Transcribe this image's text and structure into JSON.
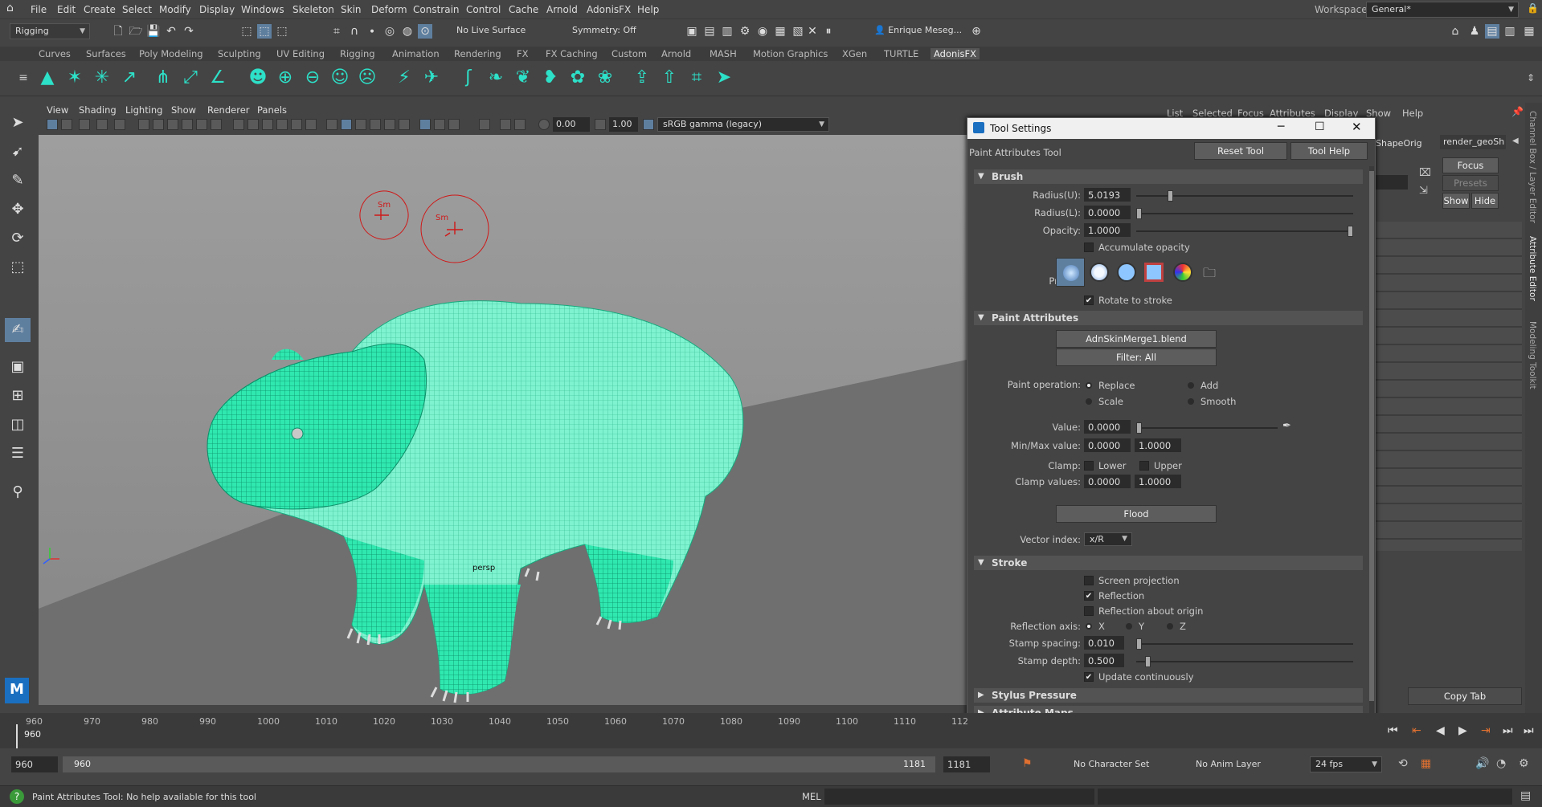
{
  "menubar": {
    "items": [
      "File",
      "Edit",
      "Create",
      "Select",
      "Modify",
      "Display",
      "Windows",
      "Skeleton",
      "Skin",
      "Deform",
      "Constrain",
      "Control",
      "Cache",
      "Arnold",
      "AdonisFX",
      "Help"
    ],
    "workspace_label": "Workspace:",
    "workspace_value": "General*"
  },
  "statusline": {
    "mode": "Rigging",
    "live_surface": "No Live Surface",
    "symmetry": "Symmetry: Off",
    "user": "Enrique Meseg..."
  },
  "shelf": {
    "tabs": [
      "Curves",
      "Surfaces",
      "Poly Modeling",
      "Sculpting",
      "UV Editing",
      "Rigging",
      "Animation",
      "Rendering",
      "FX",
      "FX Caching",
      "Custom",
      "Arnold",
      "MASH",
      "Motion Graphics",
      "XGen",
      "TURTLE",
      "AdonisFX"
    ],
    "active_tab": "AdonisFX"
  },
  "viewport": {
    "menus": [
      "View",
      "Shading",
      "Lighting",
      "Show",
      "Renderer",
      "Panels"
    ],
    "exposure": "0.00",
    "gamma": "1.00",
    "colorspace": "sRGB gamma (legacy)",
    "camera": "persp",
    "brush_label_1": "Sm",
    "brush_label_2": "Sm"
  },
  "right_panel": {
    "menus": [
      "List",
      "Selected",
      "Focus",
      "Attributes",
      "Display",
      "Show",
      "Help"
    ],
    "tab1": "ShapeOrig",
    "tab2": "render_geoSh",
    "focus": "Focus",
    "presets": "Presets",
    "show": "Show",
    "hide": "Hide",
    "copy_tab": "Copy Tab",
    "side_tabs": [
      "Channel Box / Layer Editor",
      "Attribute Editor",
      "Modeling Toolkit"
    ]
  },
  "tool_settings": {
    "title": "Tool Settings",
    "tool_name": "Paint Attributes Tool",
    "reset": "Reset Tool",
    "help": "Tool Help",
    "brush": {
      "header": "Brush",
      "radius_u_label": "Radius(U):",
      "radius_u": "5.0193",
      "radius_u_pos": 0.15,
      "radius_l_label": "Radius(L):",
      "radius_l": "0.0000",
      "radius_l_pos": 0.0,
      "opacity_label": "Opacity:",
      "opacity": "1.0000",
      "opacity_pos": 1.0,
      "accumulate": "Accumulate opacity",
      "accumulate_checked": false,
      "profile_label": "Profile:",
      "rotate": "Rotate to stroke",
      "rotate_checked": true
    },
    "paint_attributes": {
      "header": "Paint Attributes",
      "attribute": "AdnSkinMerge1.blend",
      "filter": "Filter: All",
      "operation_label": "Paint operation:",
      "ops": [
        "Replace",
        "Add",
        "Scale",
        "Smooth"
      ],
      "selected_op": "Replace",
      "value_label": "Value:",
      "value": "0.0000",
      "value_pos": 0.0,
      "minmax_label": "Min/Max value:",
      "min": "0.0000",
      "max": "1.0000",
      "clamp_label": "Clamp:",
      "clamp_lower": "Lower",
      "clamp_upper": "Upper",
      "clamp_values_label": "Clamp values:",
      "clamp_min": "0.0000",
      "clamp_max": "1.0000",
      "flood": "Flood",
      "vector_label": "Vector index:",
      "vector": "x/R"
    },
    "stroke": {
      "header": "Stroke",
      "screen_projection": "Screen projection",
      "screen_projection_checked": false,
      "reflection": "Reflection",
      "reflection_checked": true,
      "reflection_origin": "Reflection about origin",
      "reflection_origin_checked": false,
      "axis_label": "Reflection axis:",
      "axes": [
        "X",
        "Y",
        "Z"
      ],
      "selected_axis": "X",
      "stamp_spacing_label": "Stamp spacing:",
      "stamp_spacing": "0.010",
      "stamp_spacing_pos": 0.0,
      "stamp_depth_label": "Stamp depth:",
      "stamp_depth": "0.500",
      "stamp_depth_pos": 0.04,
      "update": "Update continuously",
      "update_checked": true
    },
    "collapsed": [
      "Stylus Pressure",
      "Attribute Maps"
    ]
  },
  "timeline": {
    "ticks": [
      "960",
      "970",
      "980",
      "990",
      "1000",
      "1010",
      "1020",
      "1030",
      "1040",
      "1050",
      "1060",
      "1070",
      "1080",
      "1090",
      "1100",
      "1110",
      "112"
    ],
    "current": "960"
  },
  "range": {
    "start": "960",
    "inner_start": "960",
    "inner_end": "1181",
    "end": "1181",
    "character_set": "No Character Set",
    "anim_layer": "No Anim Layer",
    "fps": "24 fps"
  },
  "help": {
    "message": "Paint Attributes Tool: No help available for this tool",
    "mel": "MEL"
  },
  "colors": {
    "mesh": "#2fe8b0",
    "brush_ring": "#d01818",
    "ground": "#707070",
    "bg": "#989898"
  }
}
